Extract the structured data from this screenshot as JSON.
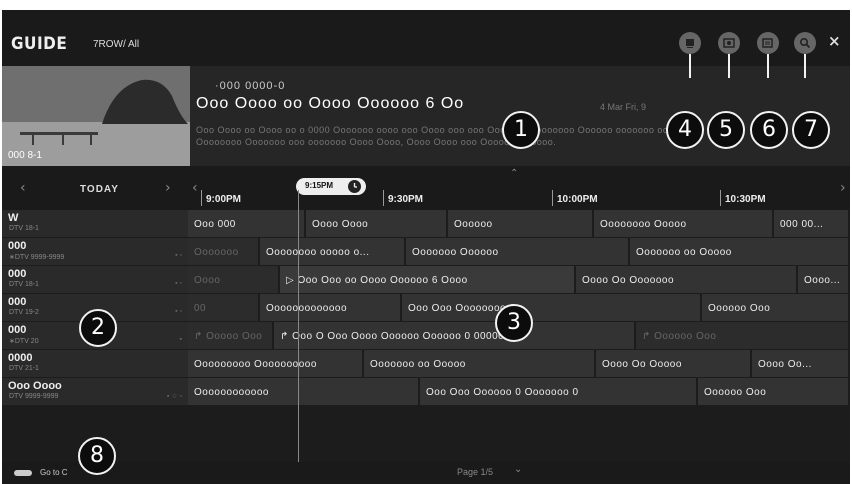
{
  "header": {
    "title": "GUIDE",
    "filter": "7ROW/ All",
    "icons": [
      "program-list-icon",
      "record-icon",
      "schedule-icon",
      "search-icon"
    ],
    "close": "×"
  },
  "info": {
    "channel_number": "000 8-1",
    "sub_title": "·000  0000-0",
    "title": "Ooo Oooo oo Oooo Oooooo 6 Oo",
    "date": "4 Mar Fri, 9",
    "description_line1": "Ooo Oooo oo Oooo oo o 0000 Ooooooo oooo ooo Oooo ooo ooo Ooooooo oooooooo Oooooo ooooooo oo ooooo",
    "description_line2": "Oooooooo Ooooooo ooo ooooooo Oooo Oooo, Oooo Oooo ooo Ooooo Ooooooo."
  },
  "timeline": {
    "day": "TODAY",
    "now_badge": "9:15PM",
    "slots": [
      "9:00PM",
      "9:30PM",
      "10:00PM",
      "10:30PM"
    ]
  },
  "channels": [
    {
      "name": "W",
      "sub": "DTV 18-1",
      "icons": "",
      "programs": [
        "Ooo 000",
        "Oooo Oooo",
        "Oooooo",
        "Oooooooo Ooooo",
        "000 00..."
      ]
    },
    {
      "name": "000",
      "sub": "∗DTV 9999-9999",
      "icons": "▪ ▫",
      "programs": [
        "Ooooooo",
        "Oooooooo ooooo o...",
        "Ooooooo Oooooo",
        "Ooooooo oo Ooooo"
      ]
    },
    {
      "name": "000",
      "sub": "DTV 18-1",
      "icons": "▪ ▫",
      "programs": [
        "Oooo",
        "▷ Ooo Ooo oo Oooo Oooooo 6 Oooo",
        "Oooo Oo Ooooooo",
        "Oooo..."
      ]
    },
    {
      "name": "000",
      "sub": "DTV 19-2",
      "icons": "▪ ▫",
      "programs": [
        "00",
        "Ooooooooooooo",
        "Ooo Ooo Oooooooo 0",
        "Oooooo Ooo"
      ]
    },
    {
      "name": "000",
      "sub": "∗DTV 20",
      "icons": "▪",
      "programs": [
        "↱ Ooooo Ooo",
        "↱ Ooo O Ooo Oooo Oooooo Oooooo 0 0000000 0",
        "↱ Oooooo Ooo"
      ]
    },
    {
      "name": "0000",
      "sub": "DTV 21-1",
      "icons": "",
      "programs": [
        "Ooooooooo Oooooooooo",
        "Ooooooo oo Ooooo",
        "Oooo Oo Ooooo",
        "Oooo Oo..."
      ]
    },
    {
      "name": "Ooo Oooo",
      "sub": "DTV 9999-9999",
      "icons": "▪ ☆ ▫",
      "programs": [
        "Oooooooooooo",
        "Ooo Ooo Oooooo 0 Ooooooo 0",
        "Oooooo Ooo"
      ]
    }
  ],
  "footer": {
    "go_to": "Go to C",
    "page": "Page 1/5"
  },
  "callouts": [
    "1",
    "2",
    "3",
    "4",
    "5",
    "6",
    "7",
    "8"
  ],
  "colors": {
    "background": "#1c1c1c",
    "cell": "#333333",
    "callout_bg": "#0c0c0c",
    "callout_border": "#f2f2f2"
  }
}
